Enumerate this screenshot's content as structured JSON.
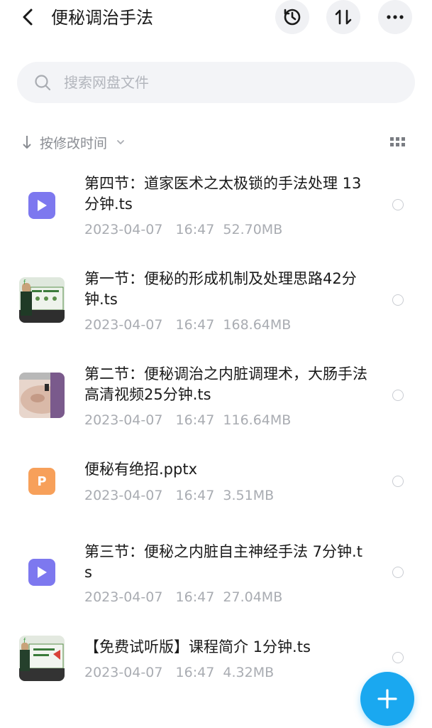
{
  "header": {
    "title": "便秘调治手法"
  },
  "search": {
    "placeholder": "搜索网盘文件"
  },
  "sort": {
    "label": "按修改时间"
  },
  "files": [
    {
      "name": "第四节：道家医术之太极锁的手法处理 13分钟.ts",
      "date": "2023-04-07",
      "time": "16:47",
      "size": "52.70MB",
      "icon": "video-file-icon"
    },
    {
      "name": "第一节：便秘的形成机制及处理思路42分钟.ts",
      "date": "2023-04-07",
      "time": "16:47",
      "size": "168.64MB",
      "icon": "video-thumbnail"
    },
    {
      "name": "第二节：便秘调治之内脏调理术，大肠手法 高清视频25分钟.ts",
      "date": "2023-04-07",
      "time": "16:47",
      "size": "116.64MB",
      "icon": "video-thumbnail"
    },
    {
      "name": "便秘有绝招.pptx",
      "date": "2023-04-07",
      "time": "16:47",
      "size": "3.51MB",
      "icon": "ppt-file-icon"
    },
    {
      "name": "第三节：便秘之内脏自主神经手法 7分钟.ts",
      "date": "2023-04-07",
      "time": "16:47",
      "size": "27.04MB",
      "icon": "video-file-icon"
    },
    {
      "name": "【免费试听版】课程简介 1分钟.ts",
      "date": "2023-04-07",
      "time": "16:47",
      "size": "4.32MB",
      "icon": "video-thumbnail"
    }
  ],
  "colors": {
    "accent": "#1aa8f0",
    "video_icon": "#7d78ef",
    "ppt_icon": "#f7a05a",
    "meta_text": "#a9acb2"
  }
}
